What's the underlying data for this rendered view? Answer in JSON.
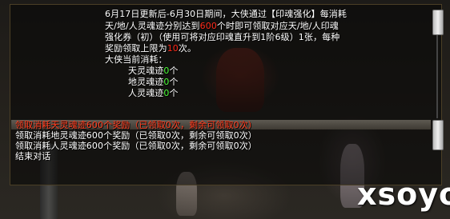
{
  "info": {
    "line1": "6月17日更新后-6月30日期间，大侠通过【印魂强化】每消耗",
    "line2_a": "天/地/人灵魂迹分别达到",
    "line2_red": "600",
    "line2_b": "个时即可领取对应天/地/人印魂",
    "line3_a": "强化券（初）（使用可将对应印魂直升到1阶6级）1张，每种",
    "line4_a": "奖励领取上限为",
    "line4_red": "10",
    "line4_b": "次。",
    "current_title": "大侠当前消耗：",
    "consumption": [
      {
        "label": "天灵魂迹",
        "value": "0",
        "unit": "个"
      },
      {
        "label": "地灵魂迹",
        "value": "0",
        "unit": "个"
      },
      {
        "label": "人灵魂迹",
        "value": "0",
        "unit": "个"
      }
    ]
  },
  "options": [
    {
      "label": "领取消耗天灵魂迹600个奖励（已领取0次，剩余可领取0次）",
      "selected": true
    },
    {
      "label": "领取消耗地灵魂迹600个奖励（已领取0次，剩余可领取0次）",
      "selected": false
    },
    {
      "label": "领取消耗人灵魂迹600个奖励（已领取0次，剩余可领取0次）",
      "selected": false
    },
    {
      "label": "结束对话",
      "selected": false
    }
  ],
  "watermark": "xsoyo",
  "colors": {
    "highlight_red": "#ff2b1a",
    "value_green": "#4cff38",
    "text_white": "#ffffff"
  }
}
